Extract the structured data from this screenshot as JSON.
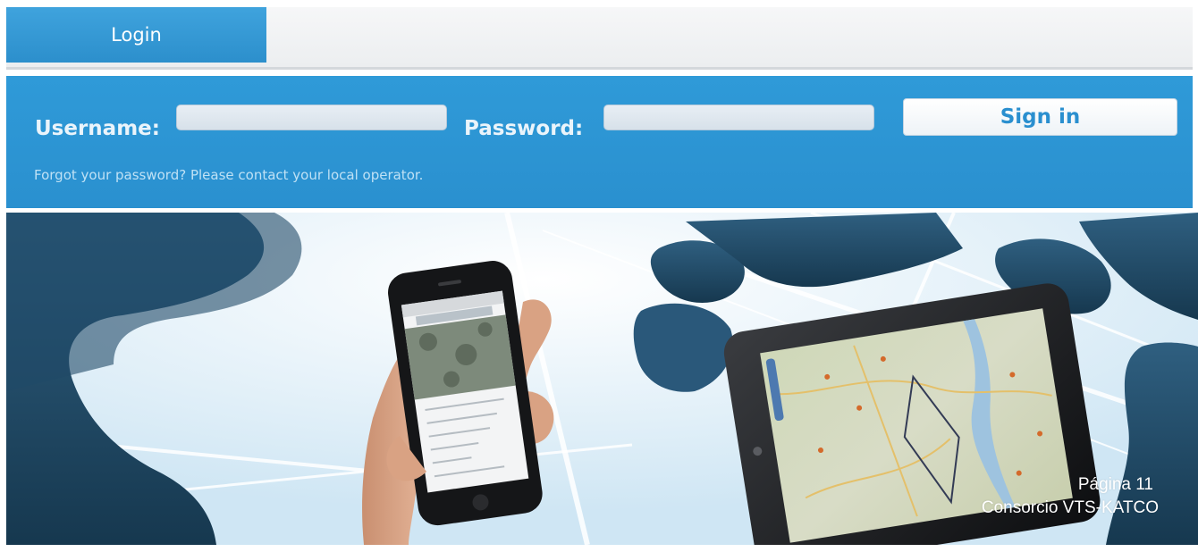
{
  "tab": {
    "label": "Login"
  },
  "login": {
    "username_label": "Username:",
    "password_label": "Password:",
    "username_value": "",
    "password_value": "",
    "signin_label": "Sign in",
    "forgot_text": "Forgot your password? Please contact your local operator."
  },
  "footer": {
    "page_label": "Página 11",
    "consortium": "Consorcio VTS-KATCO"
  },
  "colors": {
    "primary_blue": "#2f9ad8",
    "signin_text": "#2a8fcf"
  }
}
